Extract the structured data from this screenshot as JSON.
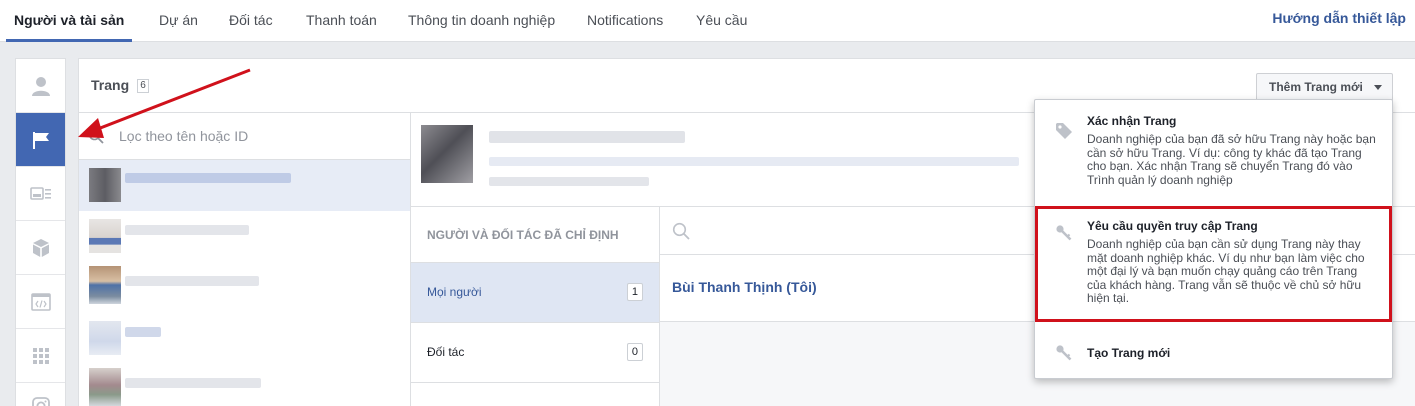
{
  "topnav": {
    "tabs": [
      {
        "label": "Người và tài sản",
        "active": true
      },
      {
        "label": "Dự án",
        "active": false
      },
      {
        "label": "Đối tác",
        "active": false
      },
      {
        "label": "Thanh toán",
        "active": false
      },
      {
        "label": "Thông tin doanh nghiệp",
        "active": false
      },
      {
        "label": "Notifications",
        "active": false
      },
      {
        "label": "Yêu cầu",
        "active": false
      }
    ],
    "help_link": "Hướng dẫn thiết lập"
  },
  "rail": {
    "items": [
      {
        "icon": "person-icon",
        "active": false
      },
      {
        "icon": "flag-icon",
        "active": true
      },
      {
        "icon": "ad-account-icon",
        "active": false
      },
      {
        "icon": "cube-icon",
        "active": false
      },
      {
        "icon": "app-code-icon",
        "active": false
      },
      {
        "icon": "grid-icon",
        "active": false
      },
      {
        "icon": "instagram-icon",
        "active": false
      }
    ]
  },
  "pages_panel": {
    "title": "Trang",
    "count": "6",
    "add_button": "Thêm Trang mới",
    "search_placeholder": "Lọc theo tên hoặc ID"
  },
  "assignments": {
    "header": "NGƯỜI VÀ ĐỐI TÁC ĐÃ CHỈ ĐỊNH",
    "tabs": [
      {
        "label": "Mọi người",
        "count": "1",
        "selected": true
      },
      {
        "label": "Đối tác",
        "count": "0",
        "selected": false
      }
    ],
    "people": [
      {
        "name": "Bùi Thanh Thịnh (Tôi)"
      }
    ]
  },
  "dropdown": {
    "items": [
      {
        "icon": "tag-icon",
        "title": "Xác nhận Trang",
        "description": "Doanh nghiệp của bạn đã sở hữu Trang này hoặc bạn cần sở hữu Trang. Ví dụ: công ty khác đã tạo Trang cho bạn. Xác nhận Trang sẽ chuyển Trang đó vào Trình quản lý doanh nghiệp"
      },
      {
        "icon": "key-icon",
        "title": "Yêu cầu quyền truy cập Trang",
        "description": "Doanh nghiệp của bạn cần sử dụng Trang này thay mặt doanh nghiệp khác. Ví dụ như bạn làm việc cho một đại lý và bạn muốn chạy quảng cáo trên Trang của khách hàng. Trang vẫn sẽ thuộc về chủ sở hữu hiện tại."
      },
      {
        "icon": "key-icon",
        "title": "Tạo Trang mới",
        "description": ""
      }
    ]
  },
  "colors": {
    "accent": "#4267b2",
    "link": "#365899",
    "annotation_red": "#d0111b"
  }
}
